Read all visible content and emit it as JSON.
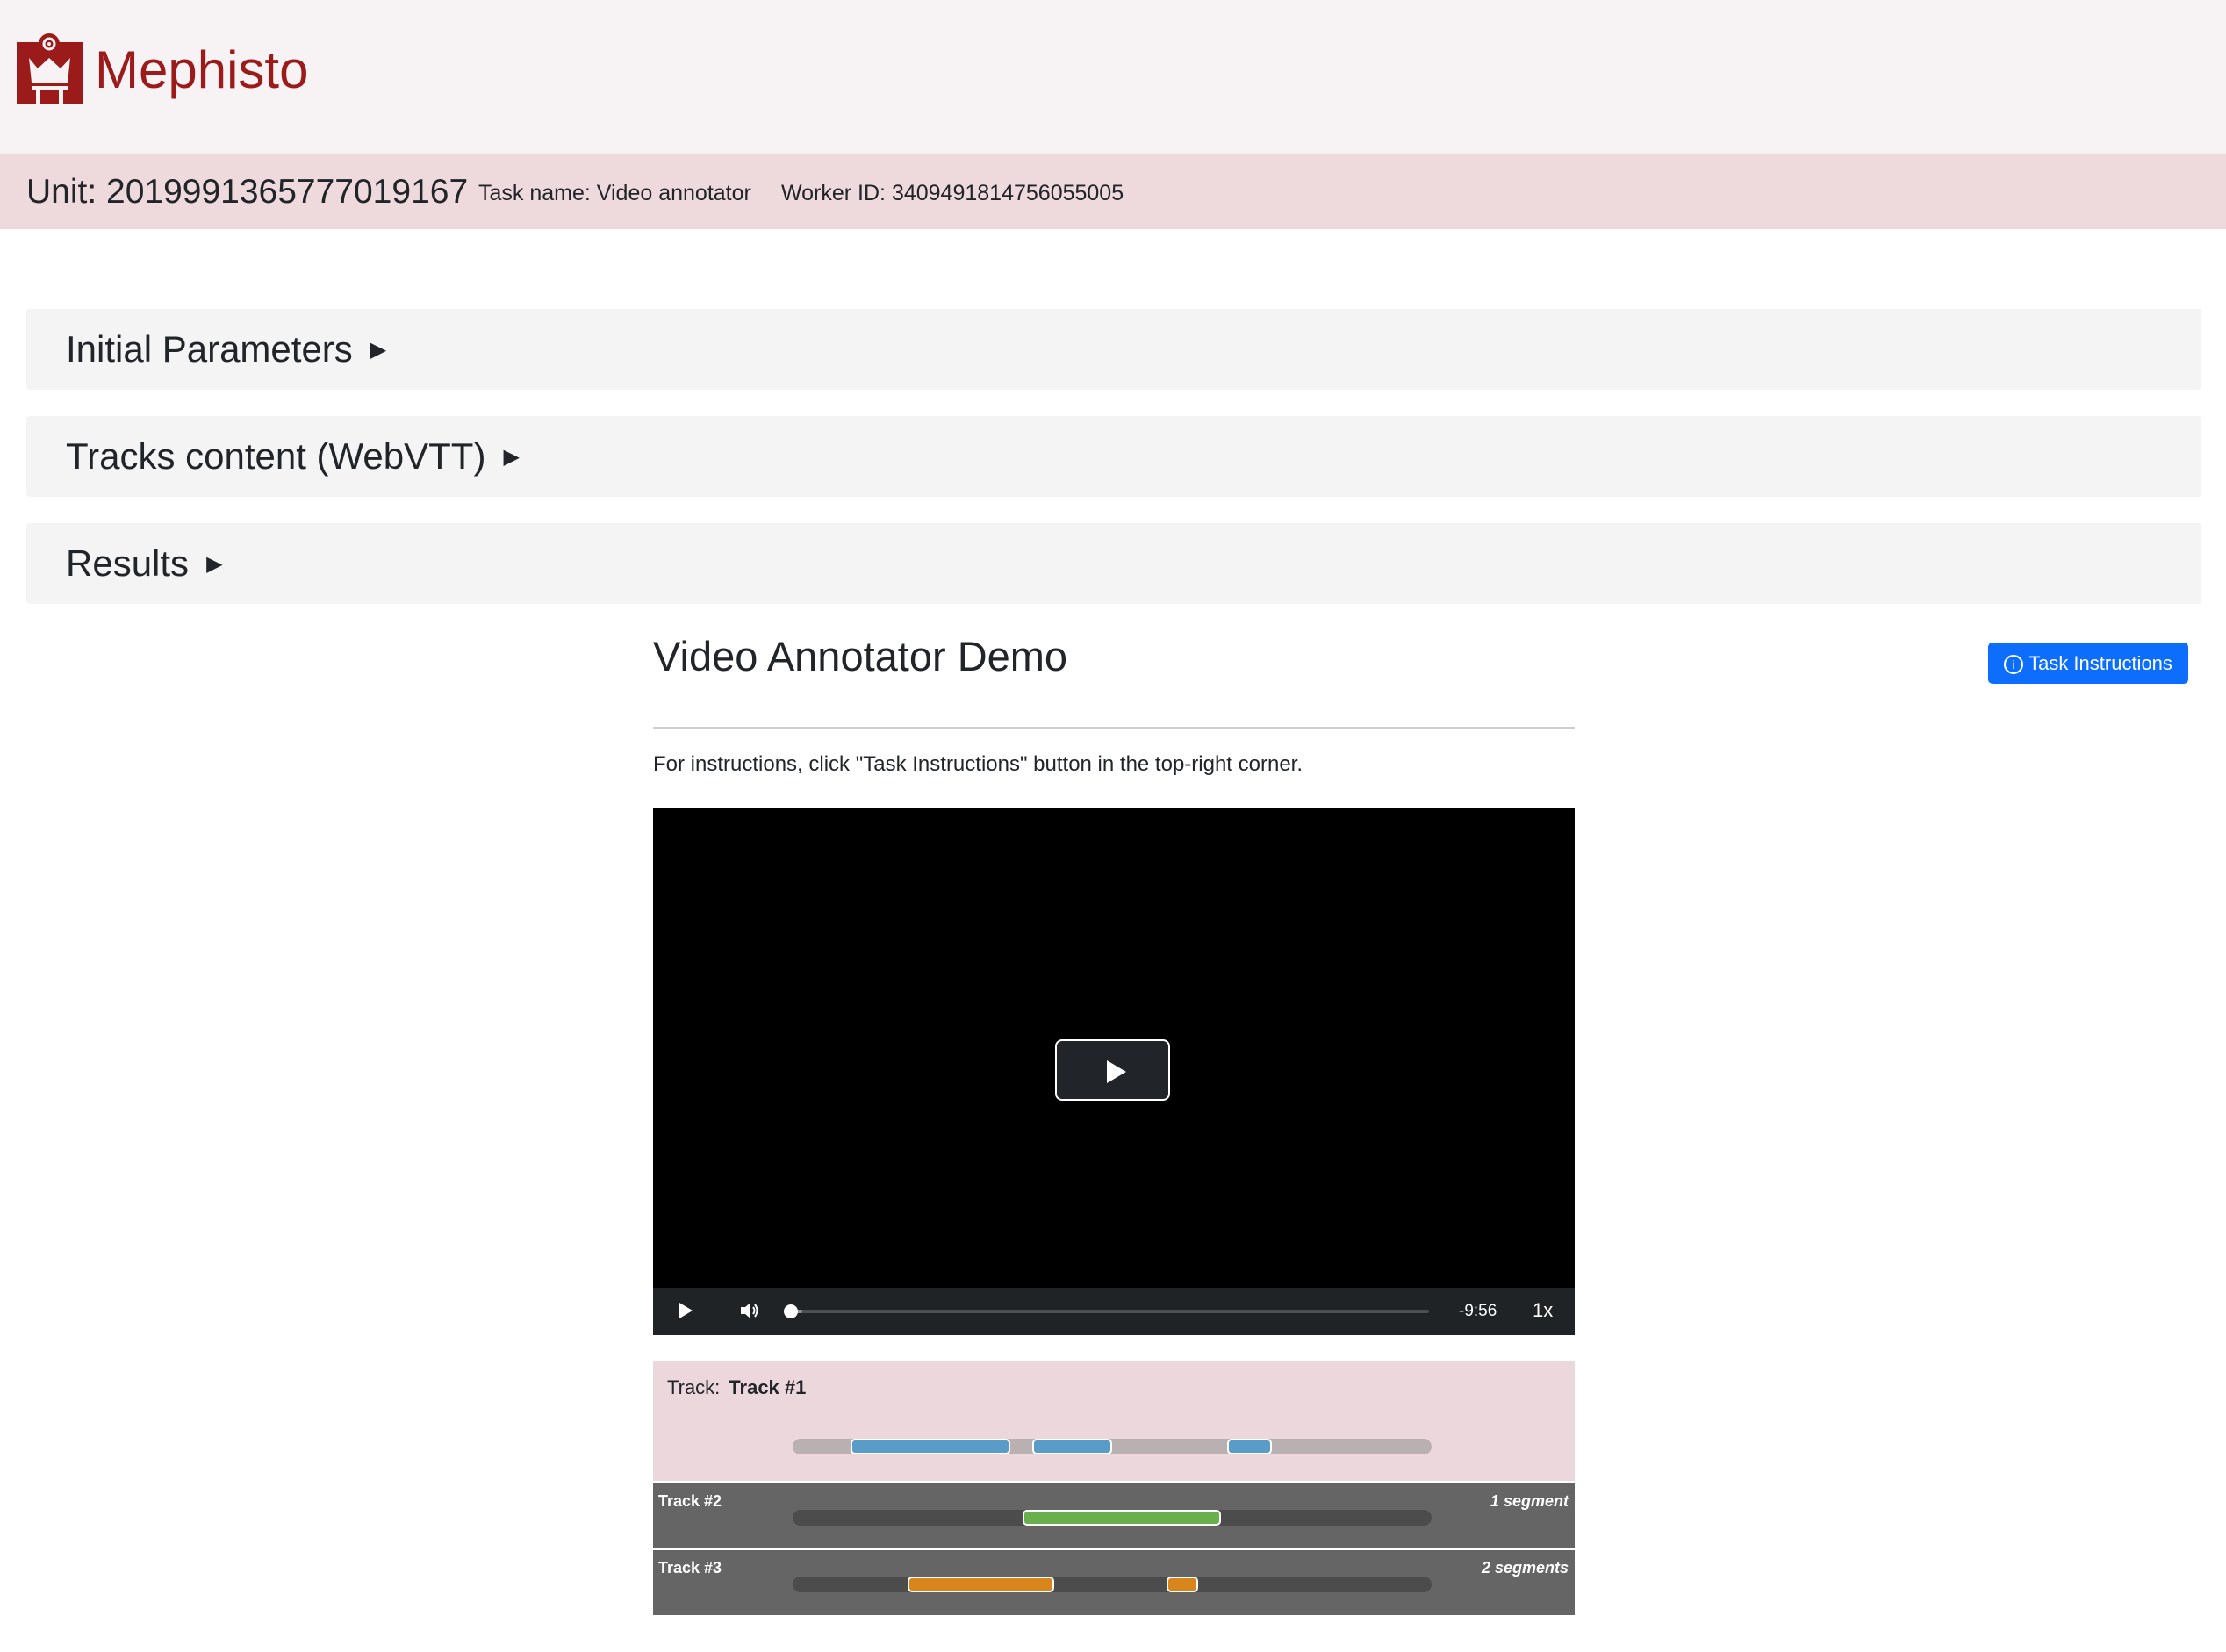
{
  "header": {
    "brand": "Mephisto",
    "brand_color": "#9b1b1b",
    "logo_icon": "mephisto-crown-logo-icon"
  },
  "unit_bar": {
    "unit_title": "Unit: 2019991365777019167",
    "task_name": "Task name: Video annotator",
    "worker_id": "Worker ID: 3409491814756055005"
  },
  "panels": [
    {
      "label": "Initial Parameters",
      "icon": "expand-triangle-icon"
    },
    {
      "label": "Tracks content (WebVTT)",
      "icon": "expand-triangle-icon"
    },
    {
      "label": "Results",
      "icon": "expand-triangle-icon"
    }
  ],
  "main": {
    "title": "Video Annotator Demo",
    "task_instructions_button": "Task Instructions",
    "instructions_text": "For instructions, click \"Task Instructions\" button in the top-right corner.",
    "accent_color": "#0d6efd"
  },
  "player": {
    "time_remaining": "-9:56",
    "speed": "1x",
    "progress_fraction": 0.02,
    "icons": [
      "big-play-icon",
      "play-icon",
      "volume-icon"
    ]
  },
  "tracks": [
    {
      "label_prefix": "Track:",
      "name": "Track #1",
      "active": true,
      "segment_color": "#5a9cc8",
      "segments": [
        [
          0.09,
          0.34
        ],
        [
          0.375,
          0.5
        ],
        [
          0.68,
          0.75
        ]
      ]
    },
    {
      "name": "Track #2",
      "count_label": "1 segment",
      "segment_color": "#6aaf4e",
      "segments": [
        [
          0.36,
          0.67
        ]
      ]
    },
    {
      "name": "Track #3",
      "count_label": "2 segments",
      "segment_color": "#d8861c",
      "segments": [
        [
          0.18,
          0.41
        ],
        [
          0.585,
          0.635
        ]
      ]
    }
  ]
}
